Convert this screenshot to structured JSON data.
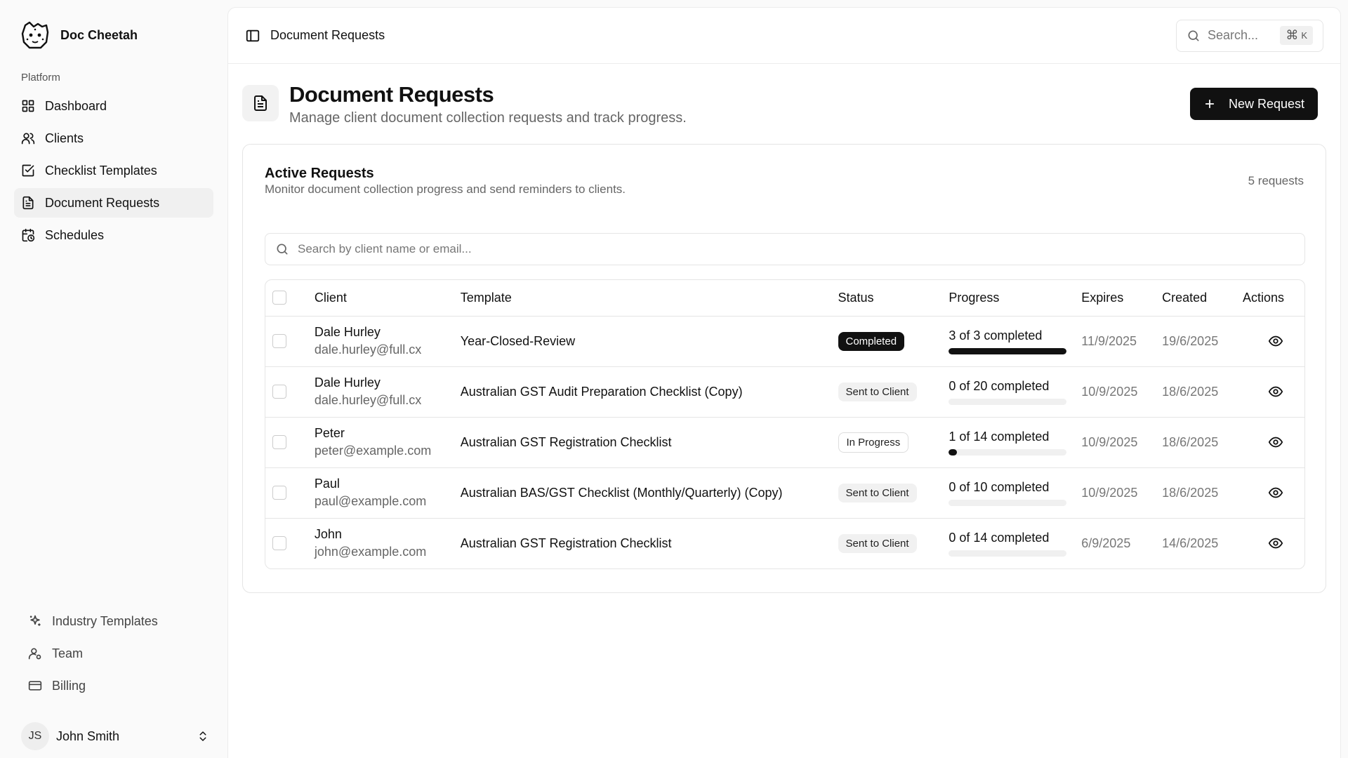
{
  "sidebar": {
    "brand": "Doc Cheetah",
    "group_label": "Platform",
    "items": [
      {
        "label": "Dashboard",
        "icon": "grid-icon"
      },
      {
        "label": "Clients",
        "icon": "users-icon"
      },
      {
        "label": "Checklist Templates",
        "icon": "check-square-icon"
      },
      {
        "label": "Document Requests",
        "icon": "file-text-icon",
        "active": true
      },
      {
        "label": "Schedules",
        "icon": "calendar-clock-icon"
      }
    ],
    "secondary": [
      {
        "label": "Industry Templates",
        "icon": "sparkles-icon"
      },
      {
        "label": "Team",
        "icon": "user-cog-icon"
      },
      {
        "label": "Billing",
        "icon": "credit-card-icon"
      }
    ],
    "user": {
      "initials": "JS",
      "name": "John Smith"
    }
  },
  "topbar": {
    "title": "Document Requests",
    "search_placeholder": "Search...",
    "shortcut_symbol": "⌘",
    "shortcut_key": "K"
  },
  "page": {
    "title": "Document Requests",
    "subtitle": "Manage client document collection requests and track progress.",
    "new_button": "New Request"
  },
  "card": {
    "title": "Active Requests",
    "description": "Monitor document collection progress and send reminders to clients.",
    "count": "5 requests",
    "filter_placeholder": "Search by client name or email..."
  },
  "table": {
    "headers": {
      "client": "Client",
      "template": "Template",
      "status": "Status",
      "progress": "Progress",
      "expires": "Expires",
      "created": "Created",
      "actions": "Actions"
    },
    "rows": [
      {
        "name": "Dale Hurley",
        "email": "dale.hurley@full.cx",
        "template": "Year-Closed-Review",
        "status": "Completed",
        "status_style": "dark",
        "progress": "3 of 3 completed",
        "progress_fraction": 1.0,
        "expires": "11/9/2025",
        "created": "19/6/2025"
      },
      {
        "name": "Dale Hurley",
        "email": "dale.hurley@full.cx",
        "template": "Australian GST Audit Preparation Checklist (Copy)",
        "status": "Sent to Client",
        "status_style": "light",
        "progress": "0 of 20 completed",
        "progress_fraction": 0.0,
        "expires": "10/9/2025",
        "created": "18/6/2025"
      },
      {
        "name": "Peter",
        "email": "peter@example.com",
        "template": "Australian GST Registration Checklist",
        "status": "In Progress",
        "status_style": "outline",
        "progress": "1 of 14 completed",
        "progress_fraction": 0.0714,
        "expires": "10/9/2025",
        "created": "18/6/2025"
      },
      {
        "name": "Paul",
        "email": "paul@example.com",
        "template": "Australian BAS/GST Checklist (Monthly/Quarterly) (Copy)",
        "status": "Sent to Client",
        "status_style": "light",
        "progress": "0 of 10 completed",
        "progress_fraction": 0.0,
        "expires": "10/9/2025",
        "created": "18/6/2025"
      },
      {
        "name": "John",
        "email": "john@example.com",
        "template": "Australian GST Registration Checklist",
        "status": "Sent to Client",
        "status_style": "light",
        "progress": "0 of 14 completed",
        "progress_fraction": 0.0,
        "expires": "6/9/2025",
        "created": "14/6/2025"
      }
    ]
  },
  "colors": {
    "accent": "#111111",
    "muted_text": "#666666",
    "border": "#e5e5e5"
  }
}
